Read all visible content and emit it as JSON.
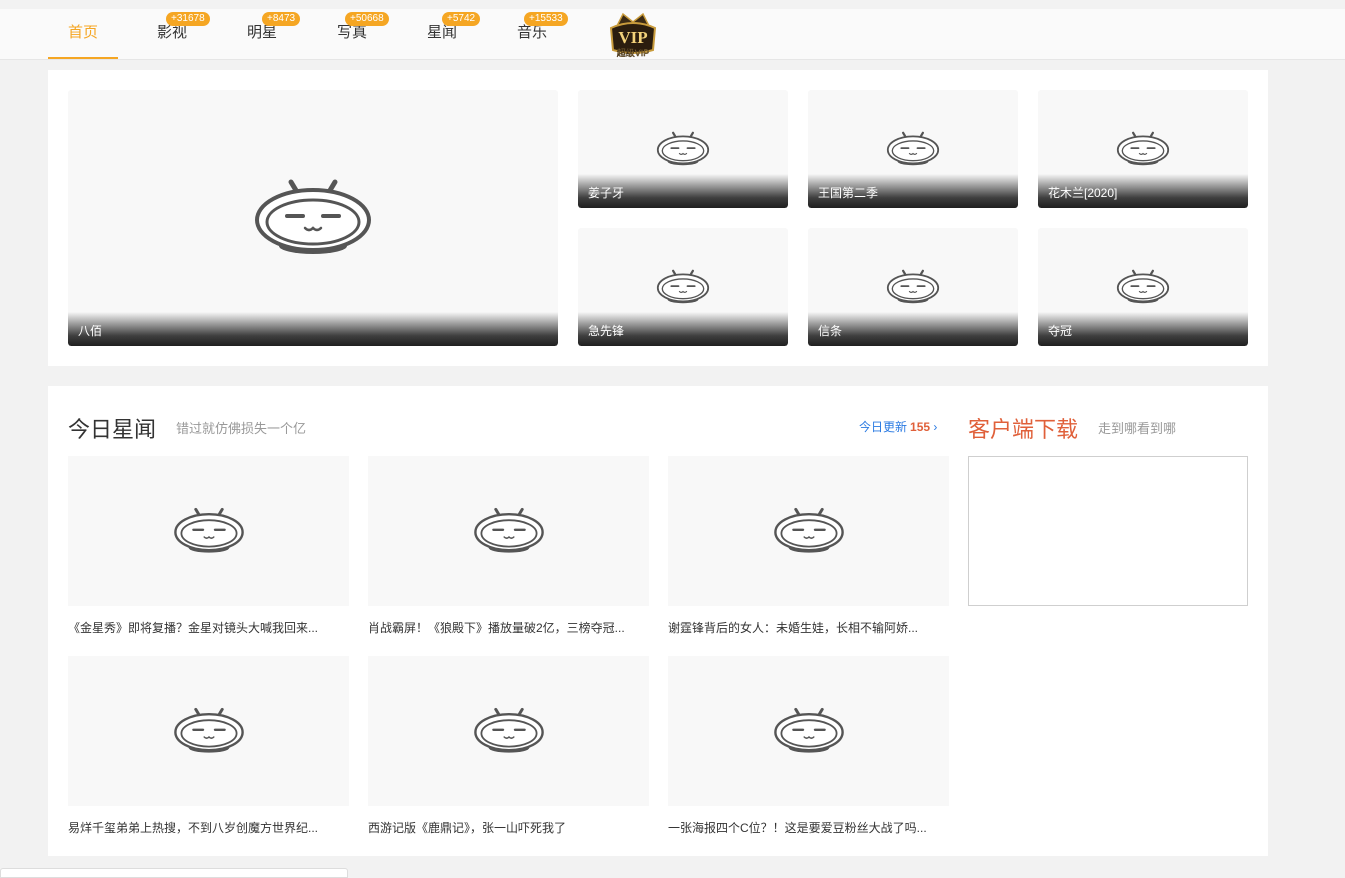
{
  "nav": {
    "items": [
      {
        "label": "首页",
        "badge": ""
      },
      {
        "label": "影视",
        "badge": "+31678"
      },
      {
        "label": "明星",
        "badge": "+8473"
      },
      {
        "label": "写真",
        "badge": "+50668"
      },
      {
        "label": "星闻",
        "badge": "+5742"
      },
      {
        "label": "音乐",
        "badge": "+15533"
      }
    ],
    "vip_text": "VIP",
    "vip_sub": "超级VIP"
  },
  "featured": {
    "main": "八佰",
    "items": [
      "姜子牙",
      "王国第二季",
      "花木兰[2020]",
      "急先锋",
      "信条",
      "夺冠"
    ]
  },
  "news": {
    "title": "今日星闻",
    "subtitle": "错过就仿佛损失一个亿",
    "update_label": "今日更新",
    "update_count": "155",
    "update_arrow": "›",
    "items": [
      "《金星秀》即将复播？金星对镜头大喊我回来...",
      "肖战霸屏！《狼殿下》播放量破2亿，三榜夺冠...",
      "谢霆锋背后的女人：未婚生娃，长相不输阿娇...",
      "易烊千玺弟弟上热搜，不到八岁创魔方世界纪...",
      "西游记版《鹿鼎记》，张一山吓死我了",
      "一张海报四个C位？！这是要爱豆粉丝大战了吗..."
    ]
  },
  "download": {
    "title": "客户端下载",
    "subtitle": "走到哪看到哪"
  },
  "colors": {
    "accent": "#f5a623",
    "link": "#2a7ae2",
    "highlight": "#e0603a"
  }
}
